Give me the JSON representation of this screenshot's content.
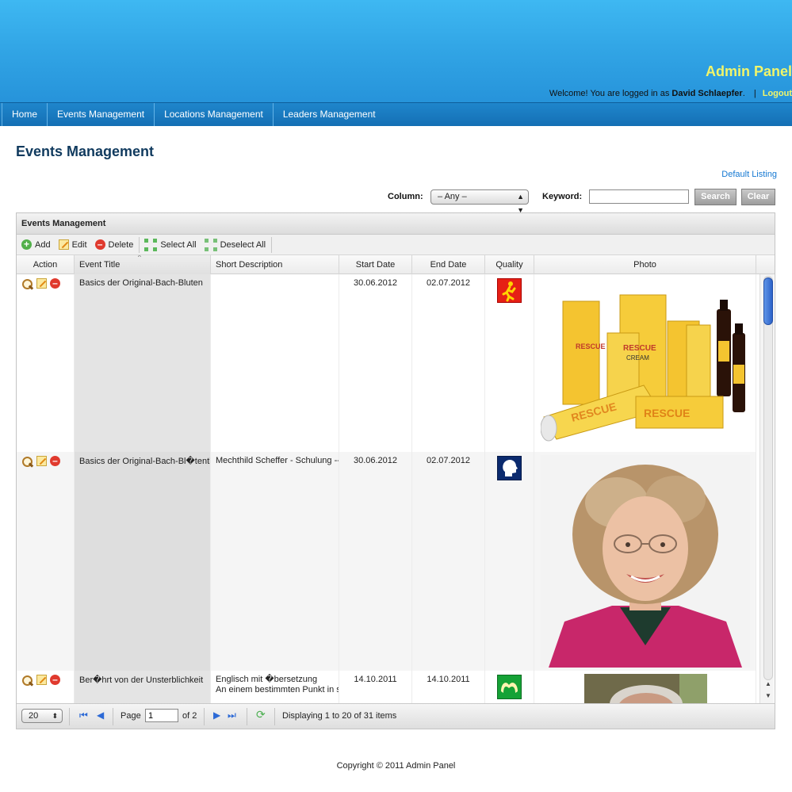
{
  "header": {
    "title": "Admin Panel",
    "welcome_prefix": "Welcome! You are logged in as",
    "user_name": "David Schlaepfer",
    "welcome_suffix": ".",
    "separator": "|",
    "logout_label": "Logout"
  },
  "nav": {
    "items": [
      {
        "label": "Home"
      },
      {
        "label": "Events Management"
      },
      {
        "label": "Locations Management"
      },
      {
        "label": "Leaders Management"
      }
    ]
  },
  "page": {
    "title": "Events Management",
    "default_listing_label": "Default Listing"
  },
  "search": {
    "column_label": "Column:",
    "column_selected": "– Any –",
    "keyword_label": "Keyword:",
    "keyword_value": "",
    "search_label": "Search",
    "clear_label": "Clear"
  },
  "grid": {
    "title": "Events Management",
    "toolbar": {
      "add_label": "Add",
      "edit_label": "Edit",
      "delete_label": "Delete",
      "select_all_label": "Select All",
      "deselect_all_label": "Deselect All"
    },
    "columns": [
      "Action",
      "Event Title",
      "Short Description",
      "Start Date",
      "End Date",
      "Quality",
      "Photo"
    ],
    "rows": [
      {
        "event_title": "Basics der Original-Bach-Bluten",
        "short_description": "",
        "start_date": "30.06.2012",
        "end_date": "02.07.2012",
        "quality_icon": "running-man-icon",
        "photo": "rescue-remedy-products"
      },
      {
        "event_title": "Basics der Original-Bach-Bl�tenth",
        "short_description": "Mechthild Scheffer - Schulung --",
        "start_date": "30.06.2012",
        "end_date": "02.07.2012",
        "quality_icon": "head-profile-icon",
        "photo": "woman-portrait"
      },
      {
        "event_title": "Ber�hrt von der Unsterblichkeit",
        "short_description_line1": "Englisch mit �bersetzung",
        "short_description_line2": "An einem bestimmten Punkt in s",
        "start_date": "14.10.2011",
        "end_date": "14.10.2011",
        "quality_icon": "hands-icon",
        "photo": "man-portrait"
      }
    ],
    "pager": {
      "page_size": "20",
      "page_label": "Page",
      "page_value": "1",
      "of_label": "of 2",
      "display_text": "Displaying 1 to 20 of 31 items"
    }
  },
  "footer": {
    "copyright": "Copyright © 2011 Admin Panel"
  },
  "colors": {
    "header_top": "#3eb8f2",
    "header_bottom": "#2693da",
    "nav_bg": "#146fb4",
    "title_yellow": "#f1f56a",
    "page_title": "#103a5e",
    "link_blue": "#1478d2"
  }
}
